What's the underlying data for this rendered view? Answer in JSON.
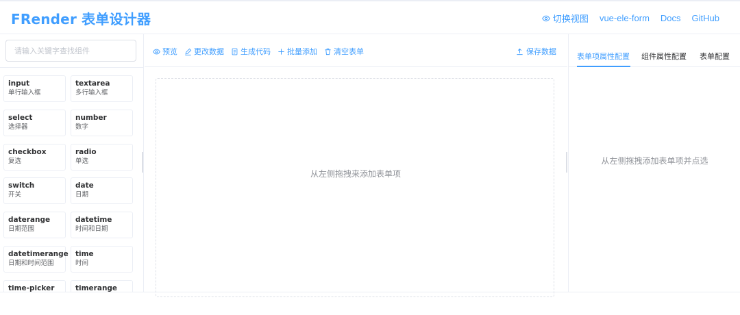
{
  "app": {
    "title": "FRender 表单设计器",
    "accent_color": "#409eff"
  },
  "nav": {
    "toggle_view": "切换视图",
    "toggle_view_icon": "eye-icon",
    "vue_ele_form": "vue-ele-form",
    "docs": "Docs",
    "github": "GitHub"
  },
  "sidebar": {
    "search_placeholder": "请输入关键字查找组件",
    "components": [
      {
        "name": "input",
        "desc": "单行输入框"
      },
      {
        "name": "textarea",
        "desc": "多行输入框"
      },
      {
        "name": "select",
        "desc": "选择器"
      },
      {
        "name": "number",
        "desc": "数字"
      },
      {
        "name": "checkbox",
        "desc": "复选"
      },
      {
        "name": "radio",
        "desc": "单选"
      },
      {
        "name": "switch",
        "desc": "开关"
      },
      {
        "name": "date",
        "desc": "日期"
      },
      {
        "name": "daterange",
        "desc": "日期范围"
      },
      {
        "name": "datetime",
        "desc": "时间和日期"
      },
      {
        "name": "datetimerange",
        "desc": "日期和时间范围"
      },
      {
        "name": "time",
        "desc": "时间"
      },
      {
        "name": "time-picker",
        "desc": ""
      },
      {
        "name": "timerange",
        "desc": ""
      }
    ]
  },
  "toolbar": {
    "preview": "预览",
    "edit_data": "更改数据",
    "generate_code": "生成代码",
    "batch_add": "批量添加",
    "clear_form": "清空表单",
    "save_data": "保存数据"
  },
  "canvas": {
    "empty_tip": "从左侧拖拽来添加表单项"
  },
  "props_panel": {
    "tabs": [
      "表单项属性配置",
      "组件属性配置",
      "表单配置"
    ],
    "active_tab": "表单项属性配置",
    "empty_tip": "从左侧拖拽添加表单项并点选"
  }
}
